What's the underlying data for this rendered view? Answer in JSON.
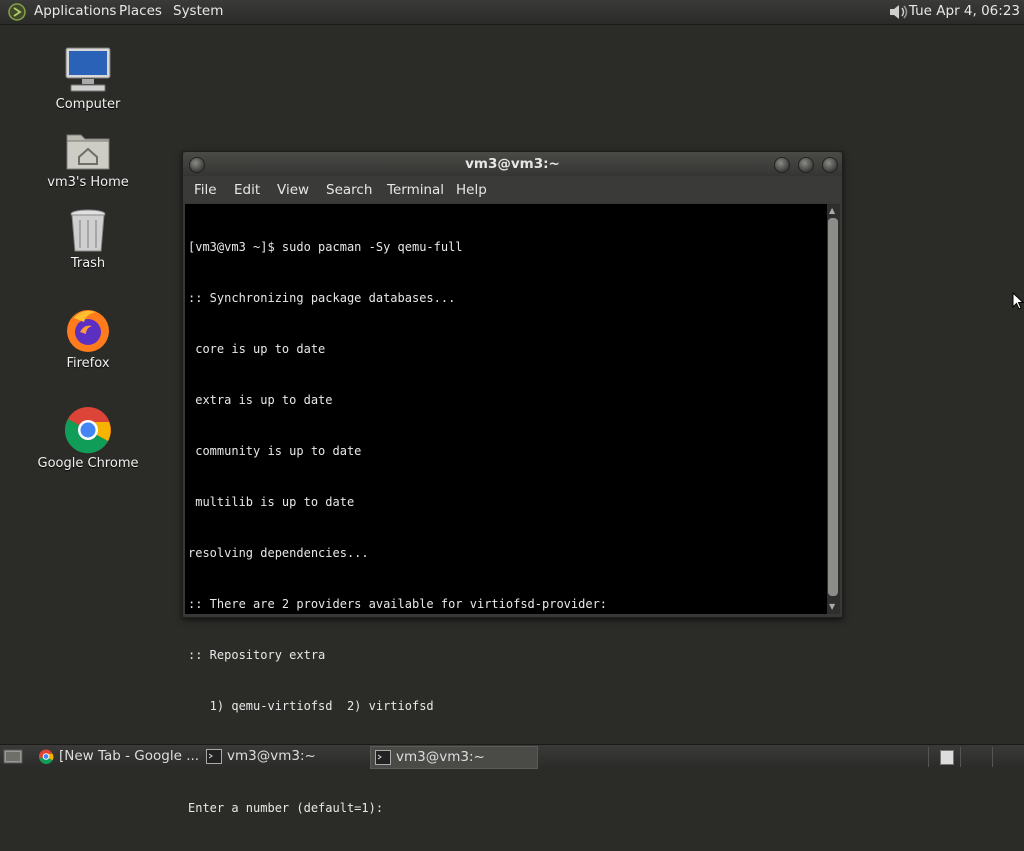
{
  "top_panel": {
    "menus": [
      "Applications",
      "Places",
      "System"
    ],
    "clock": "Tue Apr  4, 06:23",
    "volume_icon": "speaker-icon"
  },
  "desktop": {
    "icons": [
      {
        "label": "Computer",
        "icon": "computer-icon"
      },
      {
        "label": "vm3's Home",
        "icon": "home-folder-icon"
      },
      {
        "label": "Trash",
        "icon": "trash-icon"
      },
      {
        "label": "Firefox",
        "icon": "firefox-icon"
      },
      {
        "label": "Google Chrome",
        "icon": "chrome-icon"
      }
    ]
  },
  "terminal": {
    "title": "vm3@vm3:~",
    "menu": [
      "File",
      "Edit",
      "View",
      "Search",
      "Terminal",
      "Help"
    ],
    "lines": [
      "[vm3@vm3 ~]$ sudo pacman -Sy qemu-full",
      ":: Synchronizing package databases...",
      " core is up to date",
      " extra is up to date",
      " community is up to date",
      " multilib is up to date",
      "resolving dependencies...",
      ":: There are 2 providers available for virtiofsd-provider:",
      ":: Repository extra",
      "   1) qemu-virtiofsd  2) virtiofsd",
      "",
      "Enter a number (default=1):"
    ]
  },
  "taskbar": {
    "tasks": [
      {
        "label": "[New Tab - Google ...",
        "icon": "chrome-icon",
        "active": false
      },
      {
        "label": "vm3@vm3:~",
        "icon": "terminal-icon",
        "active": false
      },
      {
        "label": "vm3@vm3:~",
        "icon": "terminal-icon",
        "active": true
      }
    ]
  },
  "colors": {
    "desktop_bg": "#2b2c28",
    "terminal_bg": "#000000",
    "terminal_fg": "#e8e8e8"
  }
}
